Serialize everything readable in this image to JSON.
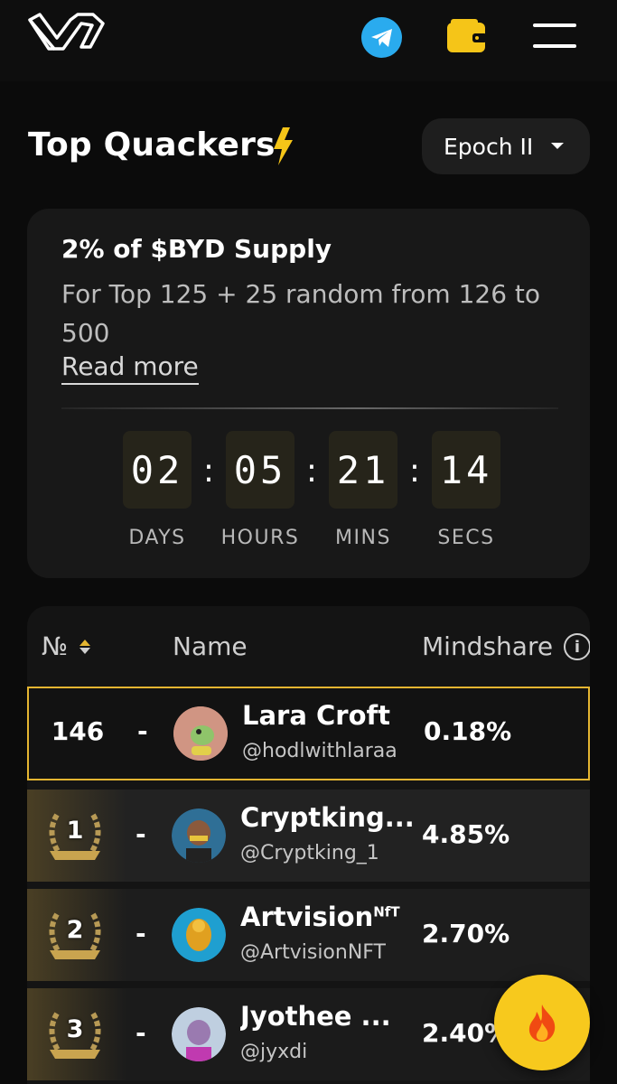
{
  "header": {
    "logo_icon": "wallchain-logo-icon",
    "telegram_icon": "telegram-icon",
    "wallet_icon": "wallet-icon",
    "menu_icon": "hamburger-menu-icon"
  },
  "page": {
    "title": "Top Quackers",
    "title_icon": "lightning-bolt-icon",
    "epoch_selected": "Epoch II"
  },
  "promo": {
    "headline": "2% of $BYD Supply",
    "description": "For Top 125 + 25 random from 126 to 500",
    "read_more": "Read more",
    "countdown": {
      "days": "02",
      "hours": "05",
      "mins": "21",
      "secs": "14",
      "separator": ":",
      "labels": {
        "days": "DAYS",
        "hours": "HOURS",
        "mins": "MINS",
        "secs": "SECS"
      }
    }
  },
  "leaderboard": {
    "columns": {
      "rank": "№",
      "name": "Name",
      "mindshare": "Mindshare",
      "info": "i"
    },
    "current_user": {
      "rank": "146",
      "change": "-",
      "name": "Lara Croft",
      "handle": "@hodlwithlaraa",
      "mindshare": "0.18%"
    },
    "rows": [
      {
        "rank": "1",
        "change": "-",
        "name": "Cryptking...",
        "handle": "@Cryptking_1",
        "mindshare": "4.85%"
      },
      {
        "rank": "2",
        "change": "-",
        "name": "Artvision",
        "name_sup": "NfT",
        "handle": "@ArtvisionNFT",
        "mindshare": "2.70%"
      },
      {
        "rank": "3",
        "change": "-",
        "name": "Jyothee ...",
        "handle": "@jyxdi",
        "mindshare": "2.40%"
      }
    ]
  },
  "fab": {
    "icon": "fire-icon"
  },
  "colors": {
    "accent": "#f7c91d",
    "highlight_border": "#e4b531",
    "telegram": "#2aabee",
    "background": "#0b0b0b"
  }
}
